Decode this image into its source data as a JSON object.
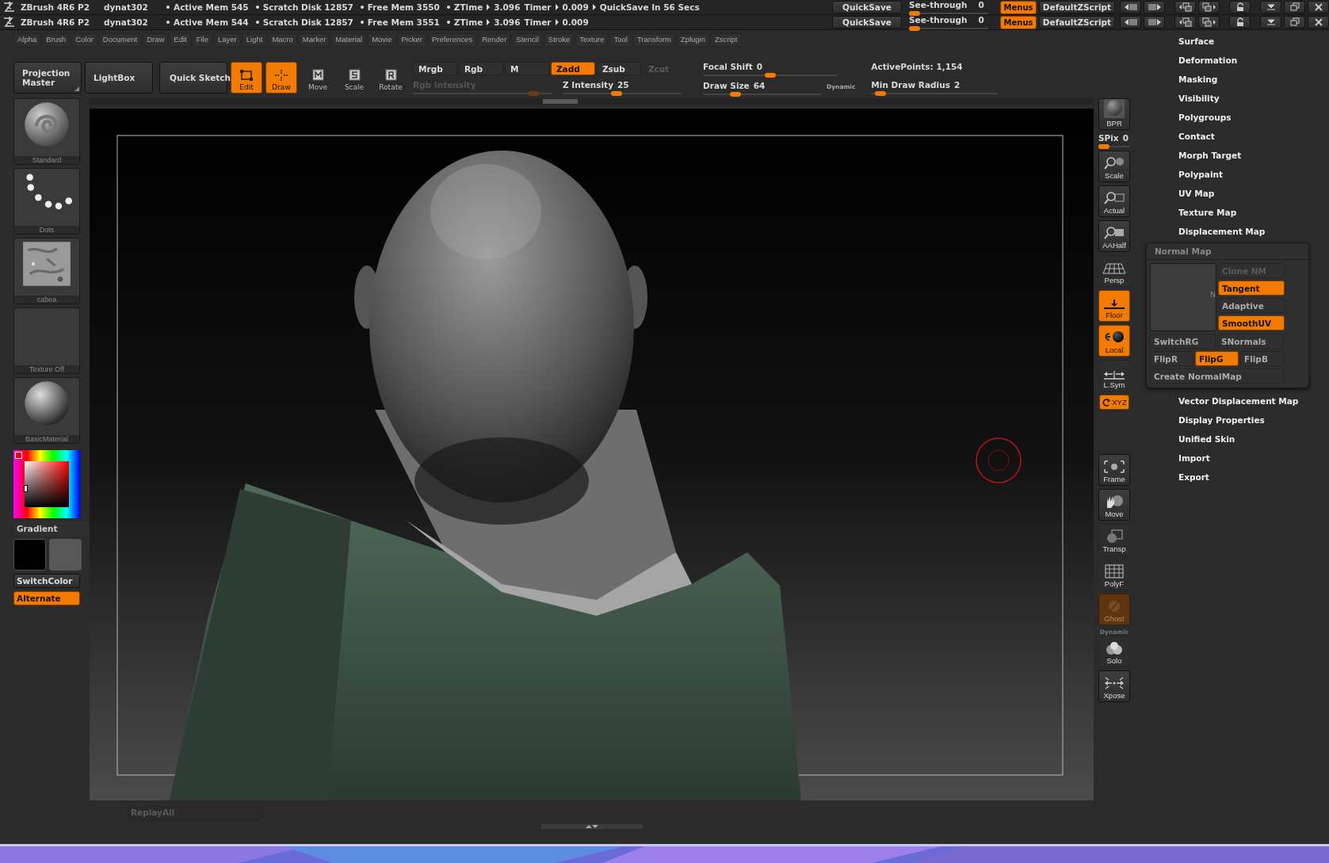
{
  "title_rows": [
    {
      "app": "ZBrush 4R6 P2",
      "document": "dynat302",
      "stats": [
        {
          "text": "Active Mem 545",
          "kind": "dot"
        },
        {
          "text": "Scratch Disk 12857",
          "kind": "dot"
        },
        {
          "text": "Free Mem 3550",
          "kind": "dot"
        },
        {
          "text": "ZTime",
          "kind": "dot"
        },
        {
          "text": "3.096",
          "kind": "arrow"
        },
        {
          "text": "Timer",
          "kind": "plain"
        },
        {
          "text": "0.009",
          "kind": "arrow"
        },
        {
          "text": "QuickSave In 56 Secs",
          "kind": "arrow"
        }
      ],
      "quicksave": "QuickSave",
      "see_through": {
        "label": "See-through",
        "value": "0",
        "level": 0
      },
      "menus": {
        "label": "Menus",
        "on": true
      },
      "script": "DefaultZScript"
    },
    {
      "app": "ZBrush 4R6 P2",
      "document": "dynat302",
      "stats": [
        {
          "text": "Active Mem 544",
          "kind": "dot"
        },
        {
          "text": "Scratch Disk 12857",
          "kind": "dot"
        },
        {
          "text": "Free Mem 3551",
          "kind": "dot"
        },
        {
          "text": "ZTime",
          "kind": "dot"
        },
        {
          "text": "3.096",
          "kind": "arrow"
        },
        {
          "text": "Timer",
          "kind": "plain"
        },
        {
          "text": "0.009",
          "kind": "arrow"
        }
      ],
      "quicksave": "QuickSave",
      "see_through": {
        "label": "See-through",
        "value": "0",
        "level": 0
      },
      "menus": {
        "label": "Menus",
        "on": true
      },
      "script": "DefaultZScript"
    }
  ],
  "menu": [
    "Alpha",
    "Brush",
    "Color",
    "Document",
    "Draw",
    "Edit",
    "File",
    "Layer",
    "Light",
    "Macro",
    "Marker",
    "Material",
    "Movie",
    "Picker",
    "Preferences",
    "Render",
    "Stencil",
    "Stroke",
    "Texture",
    "Tool",
    "Transform",
    "Zplugin",
    "Zscript"
  ],
  "shelf": {
    "tools": [
      {
        "label": "Projection Master",
        "kind": "menu",
        "on": false
      },
      {
        "label": "LightBox",
        "kind": "plain",
        "on": false
      },
      {
        "label": "Quick Sketch",
        "kind": "sketch",
        "on": false
      },
      {
        "label": "Edit",
        "kind": "edit",
        "on": true
      },
      {
        "label": "Draw",
        "kind": "draw",
        "on": true
      },
      {
        "label": "Move",
        "kind": "move",
        "on": false
      },
      {
        "label": "Scale",
        "kind": "scale",
        "on": false
      },
      {
        "label": "Rotate",
        "kind": "rotate",
        "on": false
      }
    ],
    "color_modes": [
      {
        "label": "Mrgb",
        "selected": false
      },
      {
        "label": "Rgb",
        "selected": false
      },
      {
        "label": "M",
        "selected": false
      }
    ],
    "sculpt_modes": [
      {
        "label": "Zadd",
        "selected": true,
        "disabled": false
      },
      {
        "label": "Zsub",
        "selected": false,
        "disabled": false
      },
      {
        "label": "Zcut",
        "selected": false,
        "disabled": true
      }
    ],
    "rgb_intensity": {
      "label": "Rgb Intensity",
      "level": 0.9,
      "disabled": true
    },
    "z_intensity": {
      "label": "Z Intensity",
      "value": "25",
      "level": 0.45,
      "disabled": false
    },
    "focal_shift": {
      "label": "Focal Shift",
      "value": "0",
      "level": 0.5
    },
    "draw_size": {
      "label": "Draw Size",
      "value": "64",
      "level": 0.25
    },
    "dynamic": "Dynamic",
    "active_points": "ActivePoints: 1,154",
    "min_draw_radius": {
      "label": "Min Draw Radius",
      "value": "2",
      "level": 0.03
    }
  },
  "left_shelf": {
    "thumbnails": [
      {
        "label": "Standard",
        "kind": "brush"
      },
      {
        "label": "Dots",
        "kind": "stroke"
      },
      {
        "label": "cabea",
        "kind": "alpha"
      },
      {
        "label": "Texture  Off",
        "kind": "texture"
      },
      {
        "label": "BasicMaterial",
        "kind": "material"
      }
    ],
    "gradient": "Gradient",
    "swatches": [
      {
        "color": "#000000"
      },
      {
        "color": "#585858"
      }
    ],
    "switch_color": "SwitchColor",
    "alternate": {
      "label": "Alternate",
      "on": true
    }
  },
  "right_shelf": {
    "top": [
      {
        "label": "BPR",
        "kind": "bpr",
        "on": false,
        "disabled": false
      },
      {
        "label": "SPix",
        "value": "0",
        "kind": "slider",
        "level": 0
      },
      {
        "label": "Scale",
        "kind": "scale",
        "on": false,
        "disabled": false
      },
      {
        "label": "Actual",
        "kind": "actual",
        "on": false,
        "disabled": false
      },
      {
        "label": "AAHalf",
        "kind": "aahalf",
        "on": false,
        "disabled": false
      },
      {
        "label": "Persp",
        "kind": "persp",
        "on": false,
        "disabled": false
      },
      {
        "label": "Floor",
        "kind": "floor",
        "on": true,
        "disabled": false
      },
      {
        "label": "Local",
        "kind": "local",
        "on": true,
        "disabled": false
      },
      {
        "label": "L.Sym",
        "kind": "lsym",
        "on": false,
        "disabled": false
      },
      {
        "label": "XYZ",
        "kind": "xyz",
        "on": true,
        "disabled": false
      }
    ],
    "bottom": [
      {
        "label": "Frame",
        "kind": "frame",
        "on": false,
        "disabled": false
      },
      {
        "label": "Move",
        "kind": "move",
        "on": false,
        "disabled": false
      },
      {
        "label": "Transp",
        "kind": "transp",
        "on": false,
        "disabled": false
      },
      {
        "label": "PolyF",
        "kind": "polyf",
        "on": false,
        "disabled": false
      },
      {
        "label": "Ghost",
        "kind": "ghost",
        "on": true,
        "disabled": true
      },
      {
        "label": "Solo",
        "caption": "Dynamic",
        "kind": "solo",
        "on": false,
        "disabled": false
      },
      {
        "label": "Xpose",
        "kind": "xpose",
        "on": false,
        "disabled": false
      }
    ]
  },
  "palette": {
    "items": [
      {
        "label": "Surface",
        "expanded": false
      },
      {
        "label": "Deformation",
        "expanded": false
      },
      {
        "label": "Masking",
        "expanded": false
      },
      {
        "label": "Visibility",
        "expanded": false
      },
      {
        "label": "Polygroups",
        "expanded": false
      },
      {
        "label": "Contact",
        "expanded": false
      },
      {
        "label": "Morph Target",
        "expanded": false
      },
      {
        "label": "Polypaint",
        "expanded": false
      },
      {
        "label": "UV Map",
        "expanded": false
      },
      {
        "label": "Texture Map",
        "expanded": false
      },
      {
        "label": "Displacement Map",
        "expanded": false
      },
      {
        "label": "Normal Map",
        "expanded": true,
        "preview_text": "N",
        "side_buttons": [
          {
            "label": "Clone NM",
            "on": false,
            "disabled": true
          },
          {
            "label": "Tangent",
            "on": true,
            "disabled": false
          },
          {
            "label": "Adaptive",
            "on": false,
            "disabled": false
          },
          {
            "label": "SmoothUV",
            "on": true,
            "disabled": false
          }
        ],
        "channel_buttons": [
          {
            "label": "SwitchRG",
            "on": false,
            "disabled": false
          },
          {
            "label": "SNormals",
            "on": false,
            "disabled": false
          }
        ],
        "flip_buttons": [
          {
            "label": "FlipR",
            "on": false,
            "disabled": false
          },
          {
            "label": "FlipG",
            "on": true,
            "disabled": false
          },
          {
            "label": "FlipB",
            "on": false,
            "disabled": false
          }
        ],
        "create_button": {
          "label": "Create NormalMap",
          "on": false,
          "disabled": false
        }
      },
      {
        "label": "Vector Displacement Map",
        "expanded": false
      },
      {
        "label": "Display Properties",
        "expanded": false
      },
      {
        "label": "Unified Skin",
        "expanded": false
      },
      {
        "label": "Import",
        "expanded": false
      },
      {
        "label": "Export",
        "expanded": false
      }
    ]
  },
  "replay": {
    "label": "ReplayAll",
    "disabled": true
  }
}
